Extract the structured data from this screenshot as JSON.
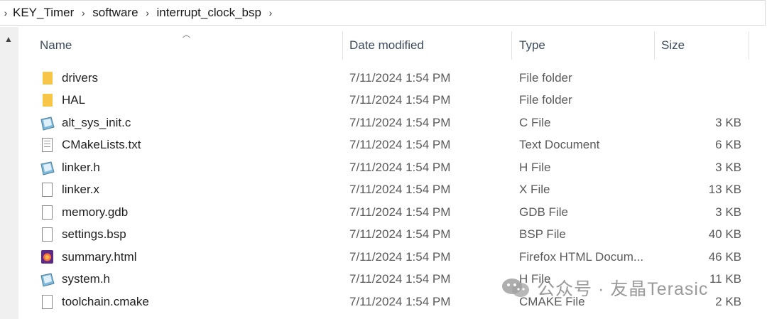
{
  "breadcrumb": {
    "items": [
      "KEY_Timer",
      "software",
      "interrupt_clock_bsp"
    ]
  },
  "columns": {
    "name": "Name",
    "date": "Date modified",
    "type": "Type",
    "size": "Size"
  },
  "files": [
    {
      "name": "drivers",
      "date": "7/11/2024 1:54 PM",
      "type": "File folder",
      "size": "",
      "icon": "folder-icon"
    },
    {
      "name": "HAL",
      "date": "7/11/2024 1:54 PM",
      "type": "File folder",
      "size": "",
      "icon": "folder-icon"
    },
    {
      "name": "alt_sys_init.c",
      "date": "7/11/2024 1:54 PM",
      "type": "C File",
      "size": "3 KB",
      "icon": "c-source-file-icon"
    },
    {
      "name": "CMakeLists.txt",
      "date": "7/11/2024 1:54 PM",
      "type": "Text Document",
      "size": "6 KB",
      "icon": "text-file-icon"
    },
    {
      "name": "linker.h",
      "date": "7/11/2024 1:54 PM",
      "type": "H File",
      "size": "3 KB",
      "icon": "c-source-file-icon"
    },
    {
      "name": "linker.x",
      "date": "7/11/2024 1:54 PM",
      "type": "X File",
      "size": "13 KB",
      "icon": "generic-file-icon"
    },
    {
      "name": "memory.gdb",
      "date": "7/11/2024 1:54 PM",
      "type": "GDB File",
      "size": "3 KB",
      "icon": "generic-file-icon"
    },
    {
      "name": "settings.bsp",
      "date": "7/11/2024 1:54 PM",
      "type": "BSP File",
      "size": "40 KB",
      "icon": "generic-file-icon"
    },
    {
      "name": "summary.html",
      "date": "7/11/2024 1:54 PM",
      "type": "Firefox HTML Docum...",
      "size": "46 KB",
      "icon": "firefox-html-icon"
    },
    {
      "name": "system.h",
      "date": "7/11/2024 1:54 PM",
      "type": "H File",
      "size": "11 KB",
      "icon": "c-source-file-icon"
    },
    {
      "name": "toolchain.cmake",
      "date": "7/11/2024 1:54 PM",
      "type": "CMAKE File",
      "size": "2 KB",
      "icon": "generic-file-icon"
    }
  ],
  "watermark": "公众号 · 友晶Terasic",
  "colors": {
    "folder": "#f7c548",
    "header_text": "#3b4a5c",
    "detail_text": "#5a5a5a"
  }
}
